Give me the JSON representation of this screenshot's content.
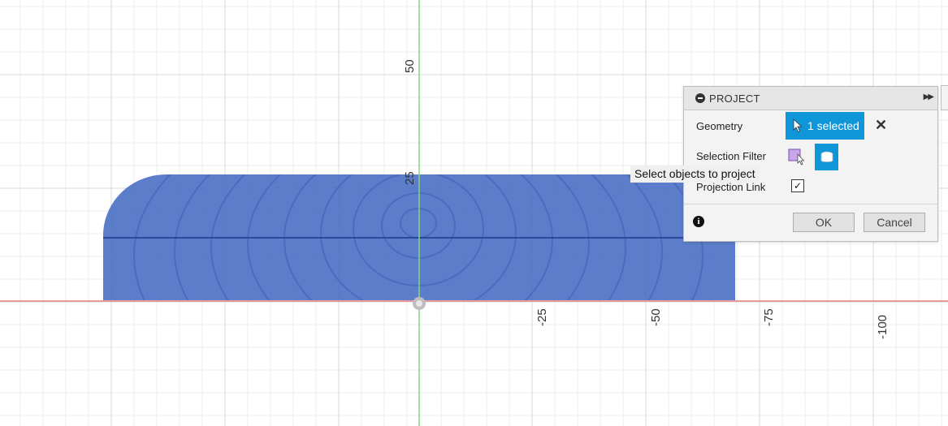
{
  "viewport": {
    "axis_ticks": {
      "vertical": [
        "50",
        "25"
      ],
      "horizontal": [
        "-25",
        "-50",
        "-75",
        "-100"
      ]
    }
  },
  "dialog": {
    "title": "PROJECT",
    "geometry_label": "Geometry",
    "geometry_value": "1 selected",
    "selection_filter_label": "Selection Filter",
    "projection_link_label": "Projection Link",
    "projection_link_checked": true,
    "ok_label": "OK",
    "cancel_label": "Cancel"
  },
  "tooltip": {
    "text": "Select objects to project"
  },
  "colors": {
    "accent": "#0f96d8",
    "x_axis": "#e88080",
    "y_axis": "#7fd77f",
    "body_fill": "#4a6fc4",
    "sketch_line": "#1d3a8a"
  },
  "icons": {
    "header_collapse": "minus-circle-icon",
    "header_expand": "double-arrow-right-icon",
    "geometry_cursor": "cursor-arrow-icon",
    "clear": "close-icon",
    "filter_face": "face-select-icon",
    "filter_body": "body-select-icon",
    "info": "info-icon"
  }
}
